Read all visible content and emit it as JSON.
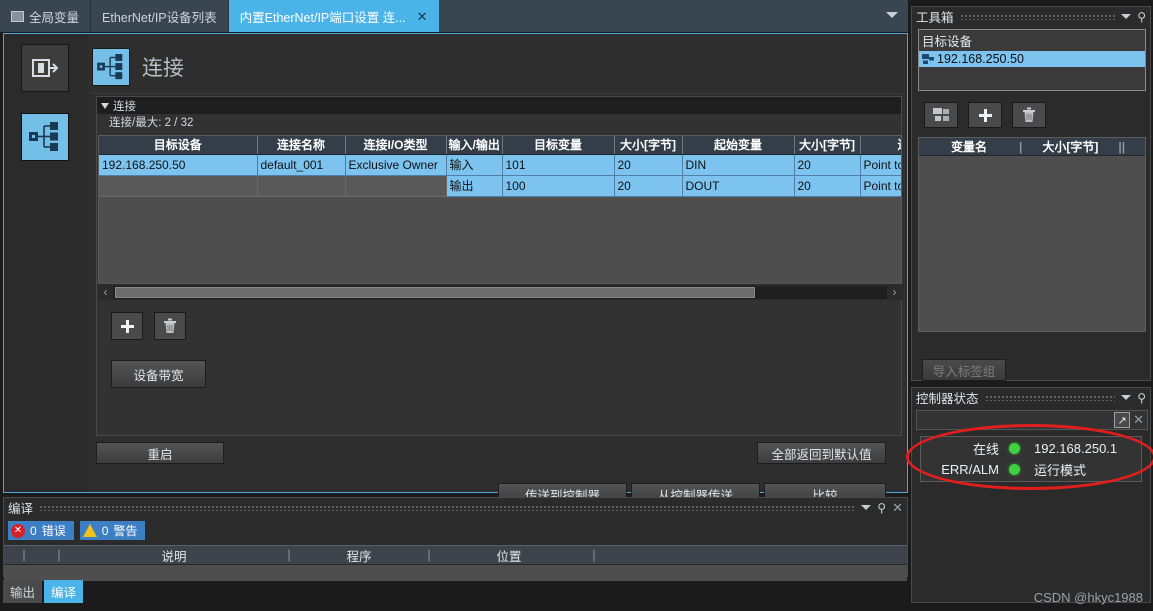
{
  "tabbar": {
    "tabs": [
      {
        "label": "全局变量",
        "icon": "grid-icon",
        "active": false,
        "closable": false
      },
      {
        "label": "EtherNet/IP设备列表",
        "icon": "",
        "active": false,
        "closable": false
      },
      {
        "label": "内置EtherNet/IP端口设置 连...",
        "icon": "",
        "active": true,
        "closable": true
      }
    ],
    "overflow_icon": "chevron-down-icon"
  },
  "editor": {
    "rail": [
      {
        "name": "port-settings-icon"
      },
      {
        "name": "connection-icon"
      }
    ],
    "page_title": "连接",
    "page_icon": "connection-icon",
    "group": {
      "caption": "连接",
      "count_label": "连接/最大: 2 / 32",
      "columns": [
        "目标设备",
        "连接名称",
        "连接I/O类型",
        "输入/输出",
        "目标变量",
        "大小[字节]",
        "起始变量",
        "大小[字节]",
        "连接"
      ],
      "rows": [
        {
          "target_device": "192.168.250.50",
          "connection_name": "default_001",
          "io_type": "Exclusive Owner",
          "direction": "输入",
          "target_variable": "101",
          "target_size": "20",
          "origin_variable": "DIN",
          "origin_size": "20",
          "connection": "Point to"
        },
        {
          "target_device": "",
          "connection_name": "",
          "io_type": "",
          "direction": "输出",
          "target_variable": "100",
          "target_size": "20",
          "origin_variable": "DOUT",
          "origin_size": "20",
          "connection": "Point to"
        }
      ]
    },
    "add_button_icon": "plus-icon",
    "delete_button_icon": "trash-icon",
    "bandwidth_button": "设备带宽",
    "restart_button": "重启",
    "reset_defaults_button": "全部返回到默认值",
    "transfer_to_controller_button": "传送到控制器",
    "transfer_from_controller_button": "从控制器传送",
    "compare_button": "比较"
  },
  "toolbox": {
    "title": "工具箱",
    "list_header": "目标设备",
    "list_items": [
      "192.168.250.50"
    ],
    "buttons": [
      {
        "name": "register-device-button",
        "icon": "device-register-icon"
      },
      {
        "name": "add-device-button",
        "icon": "plus-icon"
      },
      {
        "name": "delete-device-button",
        "icon": "trash-icon"
      }
    ],
    "variable_columns": [
      "变量名",
      "大小[字节]"
    ],
    "import_button": "导入标签组"
  },
  "controller_status": {
    "title": "控制器状态",
    "expand_icon": "expand-icon",
    "close_icon": "close-icon",
    "rows": [
      {
        "label": "在线",
        "led": "green",
        "value": "192.168.250.1"
      },
      {
        "label": "ERR/ALM",
        "led": "green",
        "value": "运行模式"
      }
    ],
    "annotation": "red-ellipse-highlight"
  },
  "compile_panel": {
    "title": "编译",
    "error_badge": {
      "count": "0",
      "label": "错误"
    },
    "warning_badge": {
      "count": "0",
      "label": "警告"
    },
    "columns": [
      "说明",
      "程序",
      "位置"
    ],
    "tabs": [
      {
        "label": "输出",
        "active": false
      },
      {
        "label": "编译",
        "active": true
      }
    ]
  },
  "watermark": "CSDN @hkyc1988",
  "colors": {
    "accent": "#4ab3e8",
    "selection": "#7cc4ef",
    "header": "#343e48",
    "led_green": "#3fd13f",
    "annotation_red": "#e01e1e"
  }
}
